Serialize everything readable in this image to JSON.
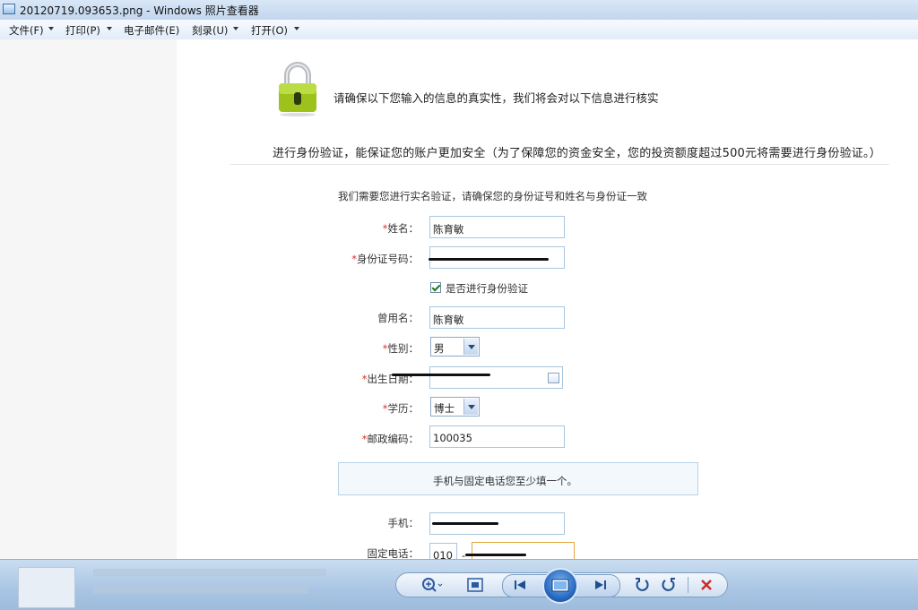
{
  "window": {
    "title": "20120719.093653.png - Windows 照片查看器"
  },
  "menu": [
    {
      "label": "文件(F)"
    },
    {
      "label": "打印(P)"
    },
    {
      "label": "电子邮件(E)"
    },
    {
      "label": "刻录(U)"
    },
    {
      "label": "打开(O)"
    }
  ],
  "page": {
    "notice": "请确保以下您输入的信息的真实性，我们将会对以下信息进行核实",
    "subtitle": "进行身份验证，能保证您的账户更加安全（为了保障您的资金安全，您的投资额度超过500元将需要进行身份验证。）",
    "intro": "我们需要您进行实名验证，请确保您的身份证号和姓名与身份证一致"
  },
  "form": {
    "required_mark": "*",
    "name": {
      "label": "姓名：",
      "value": "陈育敏"
    },
    "id_number": {
      "label": "身份证号码：",
      "value": ""
    },
    "verify": {
      "label": "是否进行身份验证",
      "checked": true
    },
    "alias": {
      "label": "曾用名：",
      "value": "陈育敏"
    },
    "gender": {
      "label": "性别：",
      "value": "男"
    },
    "birthdate": {
      "label": "出生日期：",
      "value": ""
    },
    "education": {
      "label": "学历：",
      "value": "博士"
    },
    "postcode": {
      "label": "邮政编码：",
      "value": "100035"
    },
    "contact_note": "手机与固定电话您至少填一个。",
    "mobile": {
      "label": "手机：",
      "value": ""
    },
    "landline": {
      "label": "固定电话：",
      "area_code": "010",
      "separator": "-",
      "value": ""
    }
  },
  "colors": {
    "required": "#e03030",
    "input_border": "#a9c6de",
    "focus_border": "#e3a63c"
  },
  "viewer": {
    "buttons": [
      {
        "icon": "zoom-icon"
      },
      {
        "icon": "actual-size-icon"
      },
      {
        "icon": "previous-icon"
      },
      {
        "icon": "slideshow-icon"
      },
      {
        "icon": "next-icon"
      },
      {
        "icon": "rotate-ccw-icon"
      },
      {
        "icon": "rotate-cw-icon"
      },
      {
        "icon": "delete-icon"
      }
    ]
  }
}
